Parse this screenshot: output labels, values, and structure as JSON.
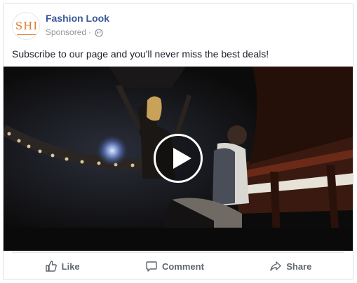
{
  "post": {
    "page_name": "Fashion Look",
    "avatar_text": "SHI",
    "sponsored_label": "Sponsored",
    "meta_separator": "·",
    "audience_icon": "globe-icon",
    "message": "Subscribe to our page and you'll never miss the best deals!",
    "video": {
      "description_icon": "play-icon"
    }
  },
  "actions": [
    {
      "label": "Like",
      "icon": "thumbs-up-icon"
    },
    {
      "label": "Comment",
      "icon": "comment-icon"
    },
    {
      "label": "Share",
      "icon": "share-icon"
    }
  ],
  "colors": {
    "page_name": "#385898",
    "meta": "#90949c",
    "text": "#1d2129",
    "action": "#606770",
    "logo": "#e07b2b"
  }
}
